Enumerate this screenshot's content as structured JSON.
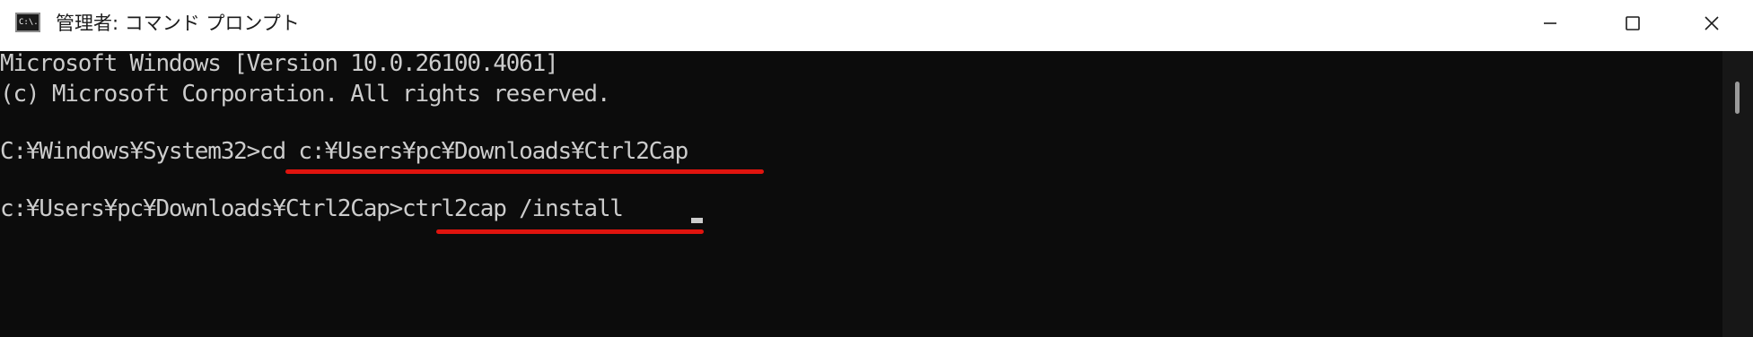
{
  "window": {
    "icon_text": "C:\\.",
    "title": "管理者: コマンド プロンプト",
    "controls": [
      "minimize-icon",
      "maximize-icon",
      "close-icon"
    ]
  },
  "console": {
    "lines": [
      "Microsoft Windows [Version 10.0.26100.4061]",
      "(c) Microsoft Corporation. All rights reserved.",
      "C:¥Windows¥System32>cd c:¥Users¥pc¥Downloads¥Ctrl2Cap",
      "c:¥Users¥pc¥Downloads¥Ctrl2Cap>ctrl2cap /install"
    ],
    "highlighted_commands": [
      "cd c:¥Users¥pc¥Downloads¥Ctrl2Cap",
      "ctrl2cap /install"
    ],
    "highlight_color": "#e0140e",
    "text_color": "#cccccc",
    "background_color": "#0c0c0c"
  }
}
